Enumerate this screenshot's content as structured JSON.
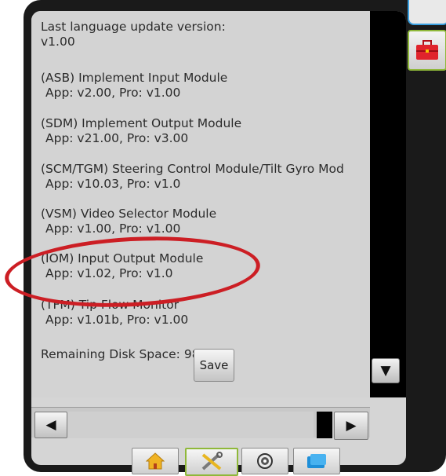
{
  "info": [
    {
      "label": "Last language update version:",
      "value": "v1.00"
    },
    {
      "label": "(ASB) Implement Input Module",
      "value": "App: v2.00, Pro: v1.00"
    },
    {
      "label": "(SDM) Implement Output Module",
      "value": "App: v21.00, Pro: v3.00"
    },
    {
      "label": "(SCM/TGM) Steering Control Module/Tilt Gyro Mod",
      "value": "App: v10.03, Pro: v1.0"
    },
    {
      "label": "(VSM) Video Selector Module",
      "value": "App: v1.00, Pro: v1.00"
    },
    {
      "label": "(IOM) Input Output Module",
      "value": "App: v1.02, Pro: v1.0"
    },
    {
      "label": "(TFM) Tip Flow Monitor",
      "value": "App: v1.01b, Pro: v1.00"
    }
  ],
  "disk_space": "Remaining Disk Space: 98%",
  "save_label": "Save",
  "colors": {
    "annotation": "#cc1e24",
    "active_tab_border": "#8fb83a",
    "top_tab_border": "#3aa0e0"
  },
  "icons": {
    "scroll_down": "triangle-down",
    "scroll_left": "triangle-left",
    "scroll_right": "triangle-right",
    "home": "house",
    "tools": "wrench-screwdriver",
    "gps": "satellite-target",
    "data": "folder",
    "toolbox": "red-toolbox"
  }
}
